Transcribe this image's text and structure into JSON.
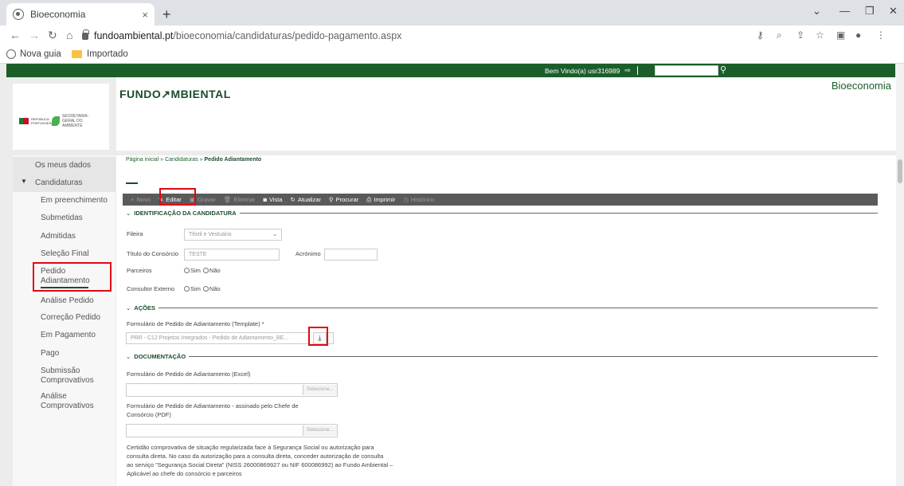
{
  "browser": {
    "tab_title": "Bioeconomia",
    "tab_close": "×",
    "new_tab": "+",
    "url_host": "fundoambiental.pt",
    "url_path": "/bioeconomia/candidaturas/pedido-pagamento.aspx",
    "bookmarks": [
      {
        "label": "Nova guia",
        "icon": "globe-icon"
      },
      {
        "label": "Importado",
        "icon": "folder-icon"
      }
    ]
  },
  "header": {
    "welcome": "Bem Vindo(a) usr316989",
    "brand": "FUNDO↗MBIENTAL",
    "app_name": "Bioeconomia",
    "logo_pt": "REPÚBLICA PORTUGUESA",
    "logo_sg": "SECRETARIA-GERAL DO AMBIENTE"
  },
  "sidebar": {
    "my_data": "Os meus dados",
    "group": "Candidaturas",
    "items": [
      "Em preenchimento",
      "Submetidas",
      "Admitidas",
      "Seleção Final",
      "Pedido Adiantamento",
      "Análise Pedido",
      "Correção Pedido",
      "Em Pagamento",
      "Pago",
      "Submissão Comprovativos",
      "Análise Comprovativos"
    ]
  },
  "breadcrumb": {
    "home": "Página inicial",
    "sep": "»",
    "section": "Candidaturas",
    "current": "Pedido Adiantamento"
  },
  "toolbar": {
    "novo": "Novo",
    "editar": "Editar",
    "gravar": "Gravar",
    "eliminar": "Eliminar",
    "vista": "Vista",
    "atualizar": "Atualizar",
    "procurar": "Procurar",
    "imprimir": "Imprimir",
    "historico": "Histórico"
  },
  "sections": {
    "identificacao": "IDENTIFICAÇÃO DA CANDIDATURA",
    "acoes": "AÇÕES",
    "documentacao": "DOCUMENTAÇÃO"
  },
  "form": {
    "fileira_label": "Fileira",
    "fileira_value": "Têxtil e Vestuário",
    "titulo_label": "Título do Consórcio",
    "titulo_value": "TESTE",
    "acronimo_label": "Acrónimo",
    "acronimo_value": "",
    "parceiros_label": "Parceiros",
    "consultor_label": "Consultor Externo",
    "sim": "Sim",
    "nao": "Não",
    "template_label": "Formulário de Pedido de Adiantamento (Template) *",
    "template_value": "PRR - C12 Projetos Integrados - Pedido de Adiantamento_BE...",
    "excel_label": "Formulário de Pedido de Adiantamento (Excel)",
    "pdf_label_1": "Formulário de Pedido de Adiantamento - assinado pelo Chefe de",
    "pdf_label_2": "Consórcio (PDF)",
    "selecione": "Selecione...",
    "cert_1": "Certidão comprovativa de situação regularizada face à Segurança Social ou autorização para",
    "cert_2": "consulta direta. No caso da autorização para a consulta direta, conceder autorização de consulta",
    "cert_3": "ao serviço \"Segurança Social Direta\" (NISS 26000869927 ou NIF 600086992) ao Fundo Ambiental –",
    "cert_4": "Aplicável ao chefe do consórcio e parceiros"
  }
}
